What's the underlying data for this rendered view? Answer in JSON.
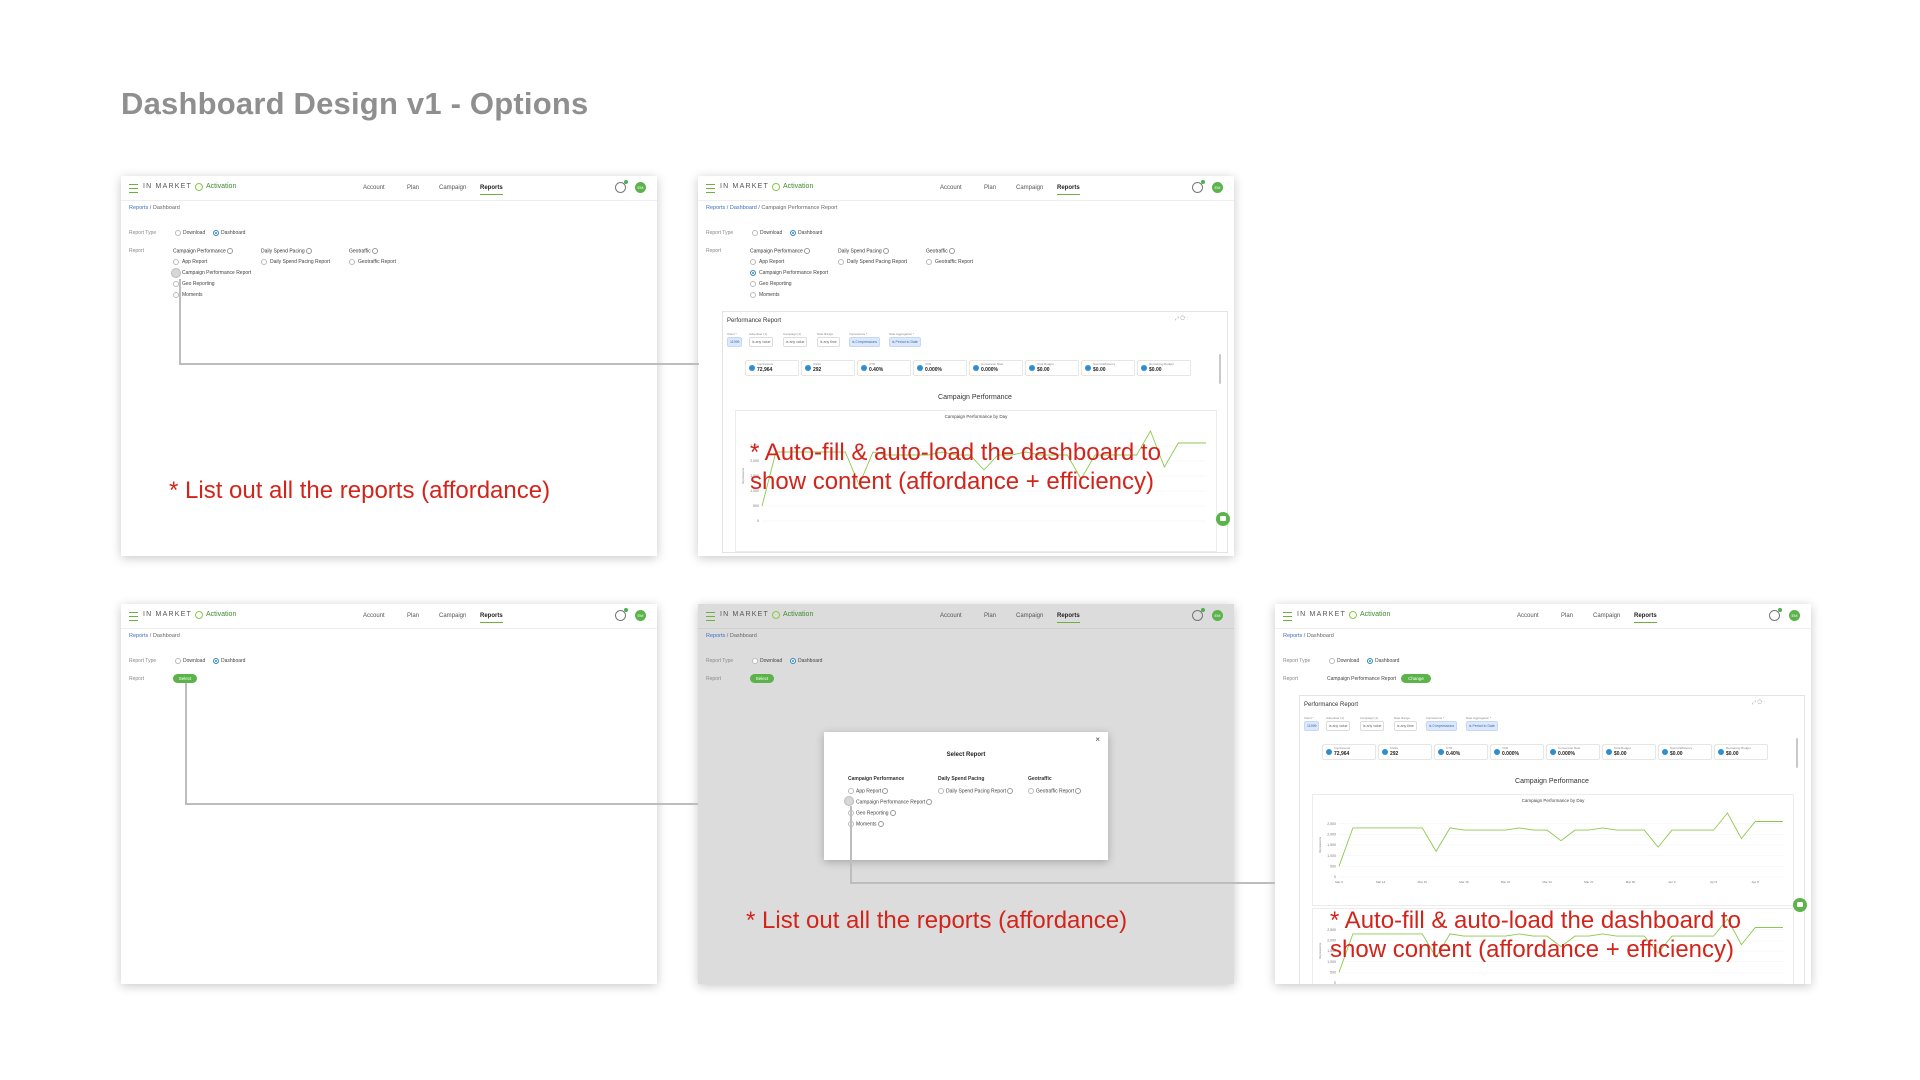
{
  "page": {
    "title": "Dashboard Design v1 - Options"
  },
  "app": {
    "logo": "IN MARKET",
    "name": "Activation",
    "nav": [
      "Account",
      "Plan",
      "Campaign",
      "Reports"
    ],
    "avatar": "EM"
  },
  "breadcrumb": {
    "reports": "Reports",
    "dashboard": "Dashboard",
    "report": "Campaign Performance Report",
    "sep": "/"
  },
  "form": {
    "report_type_label": "Report Type",
    "report_label": "Report",
    "download": "Download",
    "dashboard": "Dashboard",
    "select_button": "Select",
    "change_button": "Change",
    "selected_report": "Campaign Performance Report"
  },
  "report_groups": {
    "campaign": {
      "title": "Campaign Performance",
      "items": [
        "App Report",
        "Campaign Performance Report",
        "Geo Reporting",
        "Moments"
      ]
    },
    "pacing": {
      "title": "Daily Spend Pacing",
      "items": [
        "Daily Spend Pacing Report"
      ]
    },
    "geotraffic": {
      "title": "Geotraffic",
      "items": [
        "Geotraffic Report"
      ]
    }
  },
  "modal": {
    "title": "Select Report",
    "close": "×"
  },
  "dashboard": {
    "panel_title": "Performance Report",
    "filters": [
      {
        "label": "Client *",
        "value": "11999"
      },
      {
        "label": "Advertiser (1)",
        "value": "is any value"
      },
      {
        "label": "Campaign (1)",
        "value": "is any value"
      },
      {
        "label": "Date Range",
        "value": "is any time"
      },
      {
        "label": "Impressions *",
        "value": "is 0 impressions"
      },
      {
        "label": "Date Aggregation *",
        "value": "is Period to Date"
      }
    ],
    "kpis": [
      {
        "label": "Impressions",
        "value": "72,964"
      },
      {
        "label": "Clicks",
        "value": "292"
      },
      {
        "label": "CTR",
        "value": "0.40%"
      },
      {
        "label": "VCR",
        "value": "0.000%"
      },
      {
        "label": "Conversion Rate",
        "value": "0.000%"
      },
      {
        "label": "Total Budget",
        "value": "$0.00"
      },
      {
        "label": "Spend Efficiency",
        "value": "$0.00"
      },
      {
        "label": "Remaining Budget",
        "value": "$0.00"
      }
    ],
    "section_title": "Campaign Performance",
    "chart_title": "Campaign Performance by Day",
    "y_axis_label": "Impressions"
  },
  "annotations": {
    "list_reports": "* List out all the reports (affordance)",
    "autofill_line1": "* Auto-fill & auto-load the dashboard to",
    "autofill_line2": "show content (affordance + efficiency)"
  },
  "colors": {
    "accent_green": "#5bb349",
    "annotation_red": "#d3241b",
    "link_blue": "#3a6fc0",
    "line_green": "#8cc84b"
  },
  "chart_data": {
    "type": "line",
    "title": "Campaign Performance by Day",
    "ylabel": "Impressions",
    "x": [
      "Mar 9",
      "Mar 10",
      "Mar 11",
      "Mar 12",
      "Mar 13",
      "Mar 14",
      "Mar 15",
      "Mar 16",
      "Mar 17",
      "Mar 18",
      "Mar 19",
      "Mar 20",
      "Mar 21",
      "Mar 22",
      "Mar 23",
      "Mar 24",
      "Mar 25",
      "Mar 26",
      "Mar 27",
      "Mar 28",
      "Mar 29",
      "Mar 30",
      "Mar 31",
      "Apr 1",
      "Apr 2",
      "Apr 3",
      "Apr 4",
      "Apr 5",
      "Apr 6",
      "Apr 7",
      "Apr 8"
    ],
    "series": [
      {
        "values": [
          500,
          2300,
          2300,
          2300,
          2300,
          2300,
          2300,
          1200,
          2300,
          2200,
          2200,
          2200,
          2200,
          2300,
          2200,
          2200,
          1700,
          2200,
          2200,
          2300,
          2200,
          2200,
          2200,
          1400,
          2200,
          2200,
          2200,
          2200,
          3000,
          1800,
          2600,
          2600,
          2600
        ]
      }
    ],
    "ylim": [
      0,
      3000
    ],
    "yticks": [
      "0",
      "500",
      "1,000",
      "1,500",
      "2,000",
      "2,500"
    ],
    "grid": true
  }
}
